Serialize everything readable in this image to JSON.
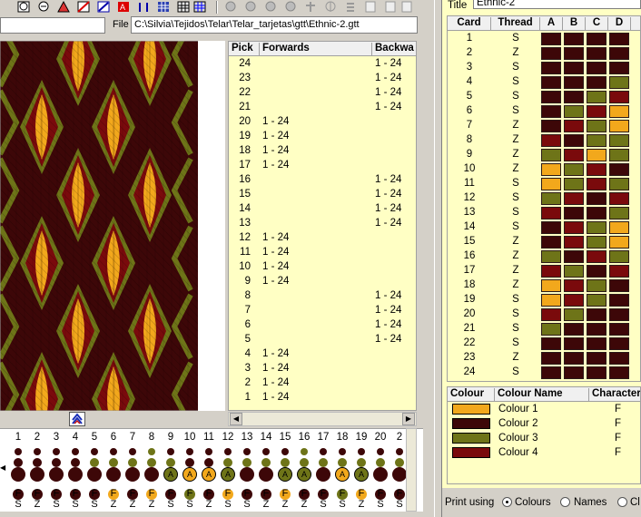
{
  "file": {
    "label": "File",
    "path": "C:\\Silvia\\Tejidos\\Telar\\Telar_tarjetas\\gtt\\Ethnic-2.gtt"
  },
  "colors": {
    "c1": "#f2a81c",
    "c2": "#3d0708",
    "c3": "#6e7418",
    "c4": "#7a0a0c",
    "bg": "#ffffc4"
  },
  "toolbar": {
    "icons": [
      "turn-icon",
      "refresh-icon",
      "flip-icon",
      "diagonal-icon",
      "pattern-icon",
      "swap-icon",
      "grid-icon",
      "grid2-icon",
      "grid3-icon",
      "circle-icon",
      "circle2-icon",
      "circle3-icon",
      "pin-icon",
      "split-icon",
      "stack-icon",
      "page-icon"
    ]
  },
  "picks": {
    "headers": [
      "Pick",
      "Forwards",
      "Backwa"
    ],
    "rows": [
      {
        "pick": "24",
        "fwd": "",
        "bwd": "1 - 24"
      },
      {
        "pick": "23",
        "fwd": "",
        "bwd": "1 - 24"
      },
      {
        "pick": "22",
        "fwd": "",
        "bwd": "1 - 24"
      },
      {
        "pick": "21",
        "fwd": "",
        "bwd": "1 - 24"
      },
      {
        "pick": "20",
        "fwd": "1 - 24",
        "bwd": ""
      },
      {
        "pick": "19",
        "fwd": "1 - 24",
        "bwd": ""
      },
      {
        "pick": "18",
        "fwd": "1 - 24",
        "bwd": ""
      },
      {
        "pick": "17",
        "fwd": "1 - 24",
        "bwd": ""
      },
      {
        "pick": "16",
        "fwd": "",
        "bwd": "1 - 24"
      },
      {
        "pick": "15",
        "fwd": "",
        "bwd": "1 - 24"
      },
      {
        "pick": "14",
        "fwd": "",
        "bwd": "1 - 24"
      },
      {
        "pick": "13",
        "fwd": "",
        "bwd": "1 - 24"
      },
      {
        "pick": "12",
        "fwd": "1 - 24",
        "bwd": ""
      },
      {
        "pick": "11",
        "fwd": "1 - 24",
        "bwd": ""
      },
      {
        "pick": "10",
        "fwd": "1 - 24",
        "bwd": ""
      },
      {
        "pick": "9",
        "fwd": "1 - 24",
        "bwd": ""
      },
      {
        "pick": "8",
        "fwd": "",
        "bwd": "1 - 24"
      },
      {
        "pick": "7",
        "fwd": "",
        "bwd": "1 - 24"
      },
      {
        "pick": "6",
        "fwd": "",
        "bwd": "1 - 24"
      },
      {
        "pick": "5",
        "fwd": "",
        "bwd": "1 - 24"
      },
      {
        "pick": "4",
        "fwd": "1 - 24",
        "bwd": ""
      },
      {
        "pick": "3",
        "fwd": "1 - 24",
        "bwd": ""
      },
      {
        "pick": "2",
        "fwd": "1 - 24",
        "bwd": ""
      },
      {
        "pick": "1",
        "fwd": "1 - 24",
        "bwd": ""
      }
    ]
  },
  "cards_strip": {
    "numbers": [
      "1",
      "2",
      "3",
      "4",
      "5",
      "6",
      "7",
      "8",
      "9",
      "10",
      "11",
      "12",
      "13",
      "14",
      "15",
      "16",
      "17",
      "18",
      "19",
      "20",
      "2"
    ],
    "rows": [
      [
        "2",
        "2",
        "2",
        "2",
        "2",
        "2",
        "2",
        "3",
        "2",
        "2",
        "2",
        "2",
        "2",
        "2",
        "2",
        "3",
        "2",
        "2",
        "2",
        "2",
        "2"
      ],
      [
        "2",
        "2",
        "2",
        "2",
        "3",
        "3",
        "3",
        "3",
        "3",
        "2",
        "2",
        "3",
        "3",
        "3",
        "3",
        "3",
        "3",
        "3",
        "3",
        "3",
        "3"
      ],
      [
        "2",
        "2",
        "2",
        "2",
        "2",
        "2",
        "2",
        "2",
        "3a",
        "1a",
        "1a",
        "3a",
        "2",
        "2",
        "3a",
        "3a",
        "2",
        "1a",
        "3a",
        "2",
        "2"
      ],
      [
        "2",
        "2",
        "2",
        "2",
        "2",
        "1",
        "2",
        "1",
        "2",
        "3",
        "2",
        "1",
        "2",
        "2",
        "1",
        "2",
        "2",
        "3",
        "1",
        "2",
        "2"
      ]
    ],
    "labels_f": "F",
    "labels_s": [
      "S",
      "Z",
      "S",
      "S",
      "S",
      "Z",
      "Z",
      "Z",
      "S",
      "S",
      "Z",
      "S",
      "S",
      "Z",
      "Z",
      "Z",
      "S",
      "S",
      "Z",
      "S",
      "S"
    ]
  },
  "title": {
    "label": "Title",
    "value": "Ethnic-2"
  },
  "threads": {
    "headers": [
      "Card",
      "Thread",
      "A",
      "B",
      "C",
      "D"
    ],
    "rows": [
      {
        "card": "1",
        "thread": "S",
        "h": [
          2,
          2,
          2,
          2
        ]
      },
      {
        "card": "2",
        "thread": "Z",
        "h": [
          2,
          2,
          2,
          2
        ]
      },
      {
        "card": "3",
        "thread": "S",
        "h": [
          2,
          2,
          2,
          2
        ]
      },
      {
        "card": "4",
        "thread": "S",
        "h": [
          2,
          2,
          2,
          3
        ]
      },
      {
        "card": "5",
        "thread": "S",
        "h": [
          2,
          2,
          3,
          4
        ]
      },
      {
        "card": "6",
        "thread": "S",
        "h": [
          2,
          3,
          4,
          1
        ]
      },
      {
        "card": "7",
        "thread": "Z",
        "h": [
          2,
          4,
          3,
          1
        ]
      },
      {
        "card": "8",
        "thread": "Z",
        "h": [
          4,
          2,
          3,
          3
        ]
      },
      {
        "card": "9",
        "thread": "Z",
        "h": [
          3,
          4,
          1,
          3
        ]
      },
      {
        "card": "10",
        "thread": "Z",
        "h": [
          1,
          3,
          4,
          2
        ]
      },
      {
        "card": "11",
        "thread": "S",
        "h": [
          1,
          3,
          4,
          3
        ]
      },
      {
        "card": "12",
        "thread": "S",
        "h": [
          3,
          4,
          2,
          4
        ]
      },
      {
        "card": "13",
        "thread": "S",
        "h": [
          4,
          2,
          2,
          3
        ]
      },
      {
        "card": "14",
        "thread": "S",
        "h": [
          2,
          4,
          3,
          1
        ]
      },
      {
        "card": "15",
        "thread": "Z",
        "h": [
          2,
          4,
          3,
          1
        ]
      },
      {
        "card": "16",
        "thread": "Z",
        "h": [
          3,
          2,
          4,
          3
        ]
      },
      {
        "card": "17",
        "thread": "Z",
        "h": [
          4,
          3,
          2,
          4
        ]
      },
      {
        "card": "18",
        "thread": "Z",
        "h": [
          1,
          4,
          3,
          2
        ]
      },
      {
        "card": "19",
        "thread": "S",
        "h": [
          1,
          4,
          3,
          2
        ]
      },
      {
        "card": "20",
        "thread": "S",
        "h": [
          4,
          3,
          2,
          2
        ]
      },
      {
        "card": "21",
        "thread": "S",
        "h": [
          3,
          2,
          2,
          2
        ]
      },
      {
        "card": "22",
        "thread": "S",
        "h": [
          2,
          2,
          2,
          2
        ]
      },
      {
        "card": "23",
        "thread": "Z",
        "h": [
          2,
          2,
          2,
          2
        ]
      },
      {
        "card": "24",
        "thread": "S",
        "h": [
          2,
          2,
          2,
          2
        ]
      }
    ]
  },
  "colours": {
    "headers": [
      "Colour",
      "Colour Name",
      "Character"
    ],
    "rows": [
      {
        "swatch": "#f2a81c",
        "name": "Colour 1",
        "char": "F"
      },
      {
        "swatch": "#3d0708",
        "name": "Colour 2",
        "char": "F"
      },
      {
        "swatch": "#6e7418",
        "name": "Colour 3",
        "char": "F"
      },
      {
        "swatch": "#7a0a0c",
        "name": "Colour 4",
        "char": "F"
      }
    ]
  },
  "print": {
    "label": "Print using",
    "options": [
      "Colours",
      "Names",
      "Cl"
    ],
    "selected": "Colours"
  }
}
